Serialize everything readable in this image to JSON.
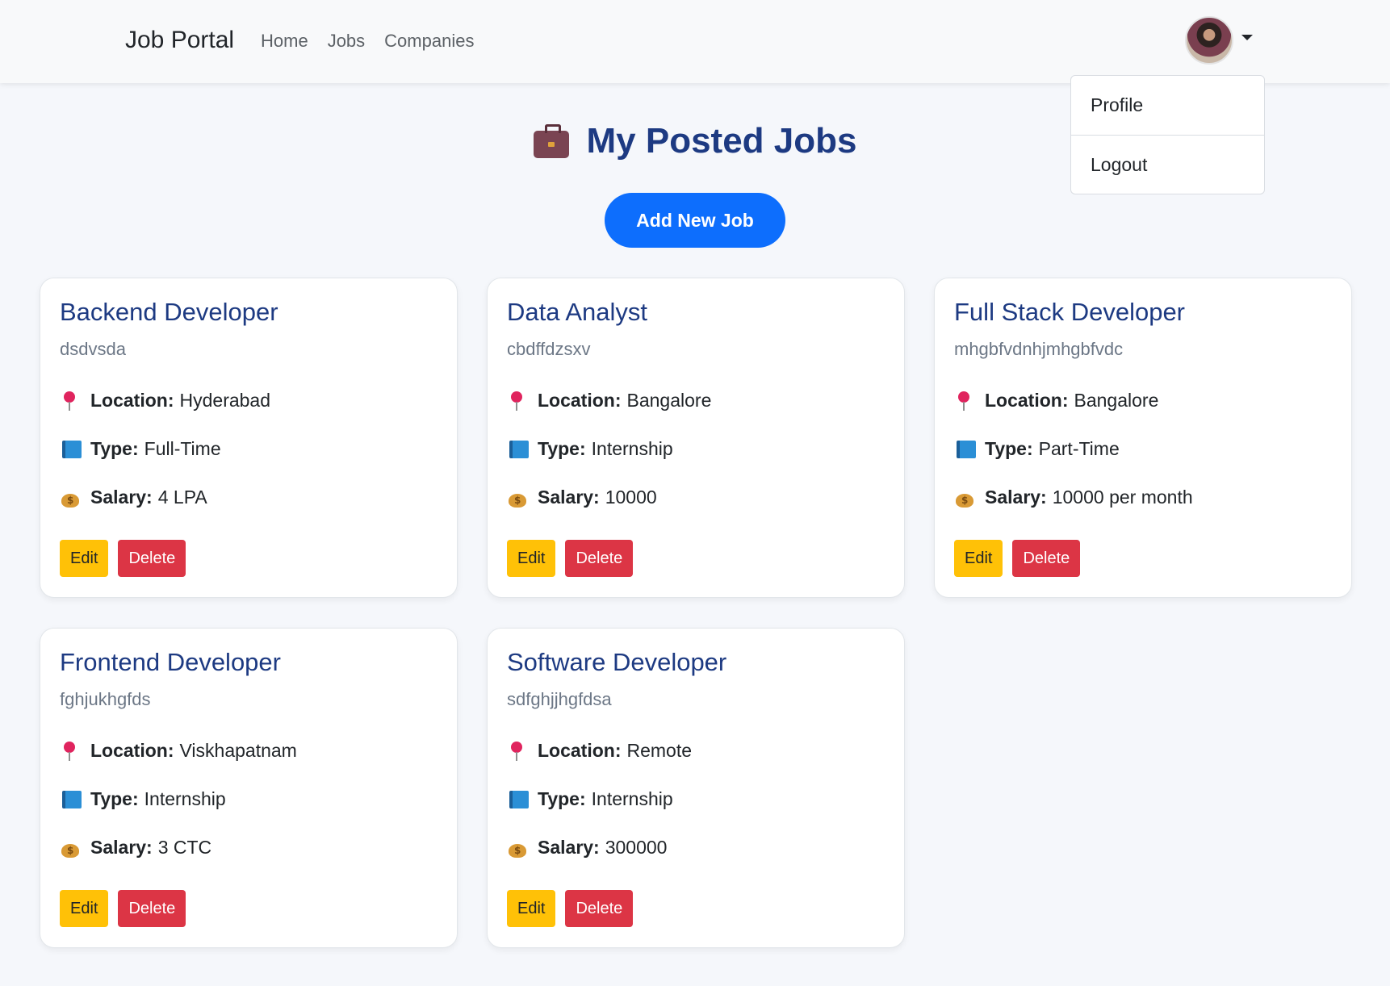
{
  "nav": {
    "brand": "Job Portal",
    "links": [
      "Home",
      "Jobs",
      "Companies"
    ]
  },
  "dropdown": {
    "items": [
      "Profile",
      "Logout"
    ]
  },
  "header": {
    "icon": "briefcase-icon",
    "title": "My Posted Jobs",
    "add_button": "Add New Job"
  },
  "labels": {
    "location": "Location:",
    "type": "Type:",
    "salary": "Salary:",
    "edit": "Edit",
    "delete": "Delete"
  },
  "jobs": [
    {
      "title": "Backend Developer",
      "description": "dsdvsda",
      "location": "Hyderabad",
      "type": "Full-Time",
      "salary": "4 LPA"
    },
    {
      "title": "Data Analyst",
      "description": "cbdffdzsxv",
      "location": "Bangalore",
      "type": "Internship",
      "salary": "10000"
    },
    {
      "title": "Full Stack Developer",
      "description": "mhgbfvdnhjmhgbfvdc",
      "location": "Bangalore",
      "type": "Part-Time",
      "salary": "10000 per month"
    },
    {
      "title": "Frontend Developer",
      "description": "fghjukhgfds",
      "location": "Viskhapatnam",
      "type": "Internship",
      "salary": "3 CTC"
    },
    {
      "title": "Software Developer",
      "description": "sdfghjjhgfdsa",
      "location": "Remote",
      "type": "Internship",
      "salary": "300000"
    }
  ],
  "colors": {
    "primary": "#0d6efd",
    "title": "#1d3a82",
    "edit": "#ffc107",
    "delete": "#dc3545"
  }
}
